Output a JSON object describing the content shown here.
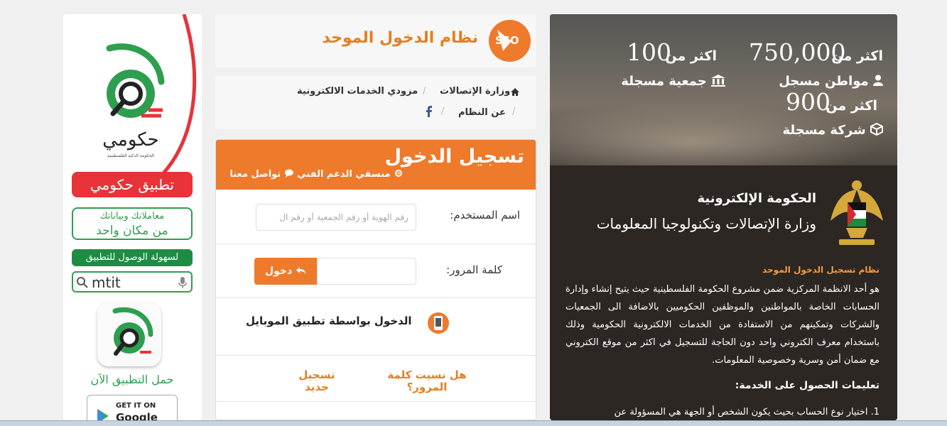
{
  "ad": {
    "brand_word": "حكومي",
    "brand_sub": "الحكومة الذكية الفلسطينية",
    "app_title": "تطبيق حكومي",
    "tagline_line1": "معاملاتك وبياناتك",
    "tagline_line2": "من مكان واحد",
    "access_text": "لسهولة الوصول للتطبيق",
    "search_query": "mtit",
    "download_text": "حمل التطبيق الآن",
    "gplay_line1": "GET IT ON",
    "gplay_line2": "Google"
  },
  "header": {
    "title": "نظام الدخول الموحد",
    "logo_text": "SSO"
  },
  "breadcrumb": {
    "items": [
      "وزارة الإتصالات",
      "مزودي الخدمات الالكترونية",
      "عن النظام"
    ]
  },
  "login": {
    "title": "تسجيل الدخول",
    "support_link": "منسقي الدعم الفني",
    "contact_link": "تواصل معنا",
    "username_label": "اسم المستخدم:",
    "username_placeholder": "رقم الهوية أو رقم الجمعية أو رقم ال",
    "password_label": "كلمة المرور:",
    "login_button": "دخول",
    "mobile_login": "الدخول بواسطة تطبيق الموبايل",
    "forgot_password": "هل نسيت كلمة المرور؟",
    "new_register": "تسجيل جديد"
  },
  "stats": {
    "citizens_prefix": "اكثر من",
    "citizens_value": "750,000",
    "citizens_label": "مواطن مسجل",
    "assoc_prefix": "اكثر من",
    "assoc_value": "100",
    "assoc_label": "جمعية مسجلة",
    "companies_prefix": "اكثر من",
    "companies_value": "900",
    "companies_label": "شركة مسجلة"
  },
  "info": {
    "gov_title": "الحكومة الإلكترونية",
    "ministry": "وزارة الإتصالات وتكنولوجيا المعلومات",
    "system_name": "نظام تسجيل الدخول الموحد",
    "description": "هو أحد الانظمة المركزية ضمن مشروع الحكومة الفلسطينية حيث يتيح إنشاء وإدارة الحسابات الخاصة بالمواطنين والموظفين الحكوميين بالاضافة الى الجمعيات والشركات وتمكينهم من الاستفادة من الخدمات الالكترونية الحكومية وذلك باستخدام معرف الكتروني واحد دون الحاجة للتسجيل في اكثر من موقع الكتروني مع ضمان أمن وسرية وخصوصية المعلومات.",
    "instructions_title": "تعليمات الحصول على الخدمة:",
    "instruction_1": "1. اختيار نوع الحساب بحيث يكون الشخص أو الجهة هي المسؤولة عن"
  },
  "colors": {
    "orange": "#ee7a2b",
    "green": "#2e9e4f",
    "red": "#e8333a",
    "dark": "#2c2723"
  }
}
